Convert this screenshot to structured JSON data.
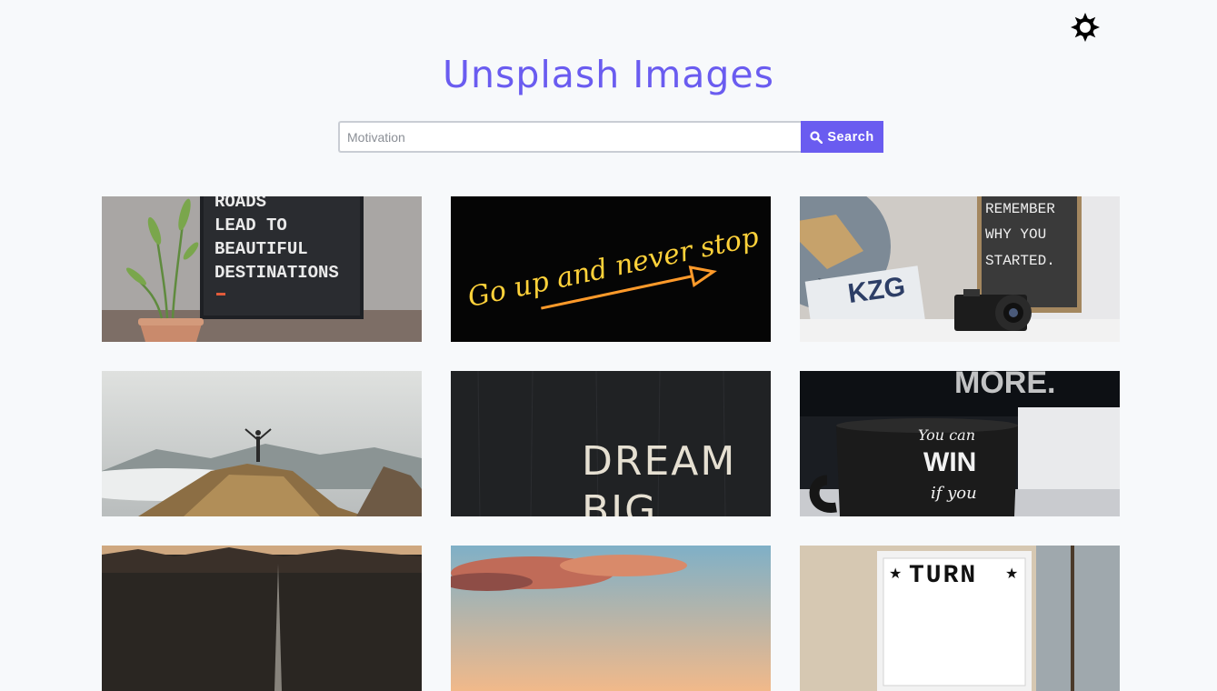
{
  "app": {
    "title": "Unsplash Images"
  },
  "theme_toggle": {
    "icon": "sun-icon"
  },
  "search": {
    "placeholder": "Motivation",
    "value": "",
    "button_label": "Search",
    "button_icon": "search-icon"
  },
  "colors": {
    "accent": "#6a5cf0",
    "background": "#f7f9fb"
  },
  "gallery": {
    "images": [
      {
        "text_lines": [
          "ROADS",
          "LEAD TO",
          "BEAUTIFUL",
          "DESTINATIONS"
        ]
      },
      {
        "text": "Go up and never stop"
      },
      {
        "text_lines": [
          "REMEMBER",
          "WHY YOU",
          "STARTED."
        ],
        "plate_text": "KZG"
      },
      {
        "text": ""
      },
      {
        "text_lines": [
          "DREAM",
          "BIG."
        ]
      },
      {
        "sign_text": "MORE.",
        "mug_lines": [
          "You can",
          "WIN",
          "if you"
        ]
      },
      {
        "text": ""
      },
      {
        "text": ""
      },
      {
        "sign_text": "TURN"
      }
    ]
  }
}
